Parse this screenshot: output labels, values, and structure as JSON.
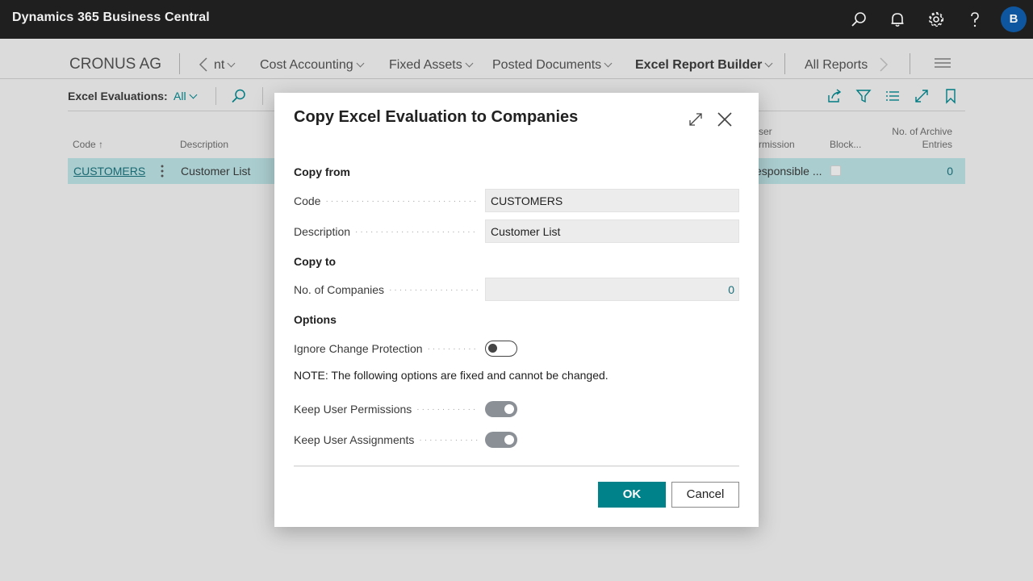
{
  "app": {
    "title": "Dynamics 365 Business Central",
    "avatar_initial": "B"
  },
  "nav": {
    "company": "CRONUS AG",
    "items": [
      {
        "label": "nt",
        "bold": false
      },
      {
        "label": "Cost Accounting",
        "bold": false
      },
      {
        "label": "Fixed Assets",
        "bold": false
      },
      {
        "label": "Posted Documents",
        "bold": false
      },
      {
        "label": "Excel Report Builder",
        "bold": true
      },
      {
        "label": "All Reports",
        "bold": false
      }
    ]
  },
  "list": {
    "view_label": "Excel Evaluations:",
    "view_value": "All",
    "columns": {
      "code": "Code ↑",
      "description": "Description",
      "user_permission": "ser\nrmission",
      "blocked": "Block...",
      "archive": "No. of Archive\nEntries"
    },
    "row": {
      "code": "CUSTOMERS",
      "description": "Customer List",
      "user_permission": "esponsible ...",
      "archive_entries": "0"
    }
  },
  "dialog": {
    "title": "Copy Excel Evaluation to Companies",
    "copy_from": "Copy from",
    "code_label": "Code",
    "code_value": "CUSTOMERS",
    "description_label": "Description",
    "description_value": "Customer List",
    "copy_to": "Copy to",
    "companies_label": "No. of Companies",
    "companies_value": "0",
    "options": "Options",
    "ignore_label": "Ignore Change Protection",
    "ignore_on": false,
    "note": "NOTE: The following options are fixed and cannot be changed.",
    "keep_perm_label": "Keep User Permissions",
    "keep_perm_on": true,
    "keep_assign_label": "Keep User Assignments",
    "keep_assign_on": true,
    "ok": "OK",
    "cancel": "Cancel"
  },
  "colors": {
    "accent": "#00828b",
    "appbar": "#212121",
    "avatar": "#0f5dab",
    "selected_row": "#b5dadc"
  }
}
